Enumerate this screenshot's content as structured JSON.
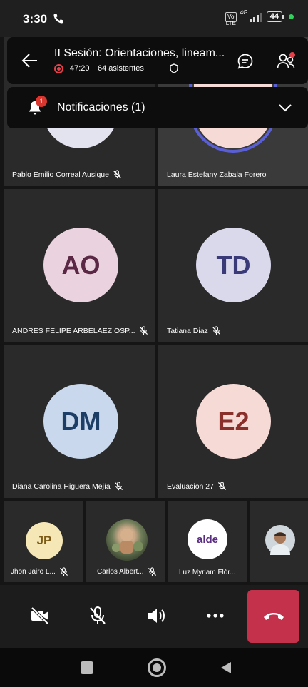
{
  "status_bar": {
    "time": "3:30",
    "network": "4G",
    "volte": "Vo LTE",
    "battery": "44"
  },
  "meeting": {
    "title": "II Sesión: Orientaciones, lineam...",
    "duration": "47:20",
    "attendees": "64 asistentes",
    "icons": [
      "back-arrow-icon",
      "recording-icon",
      "shield-icon",
      "chat-icon",
      "people-icon"
    ]
  },
  "notifications": {
    "label": "Notificaciones (1)",
    "badge": "1"
  },
  "participants_large": [
    {
      "name": "Pablo Emilio Correal Ausique",
      "initials": "",
      "muted": true
    },
    {
      "name": "Laura Estefany Zabala Forero",
      "initials": "",
      "muted": false
    },
    {
      "name": "ANDRES FELIPE ARBELAEZ OSP...",
      "initials": "AO",
      "muted": true,
      "avatar_bg": "#ead3df",
      "avatar_fg": "#5a2744"
    },
    {
      "name": "Tatiana Diaz",
      "initials": "TD",
      "muted": true,
      "avatar_bg": "#dad9ec",
      "avatar_fg": "#3a3a78"
    },
    {
      "name": "Diana Carolina Higuera Mejía",
      "initials": "DM",
      "muted": true,
      "avatar_bg": "#c9d8ec",
      "avatar_fg": "#1d3e66"
    },
    {
      "name": "Evaluacion 27",
      "initials": "E2",
      "muted": true,
      "avatar_bg": "#f6dad6",
      "avatar_fg": "#8a2f2a"
    }
  ],
  "participants_small": [
    {
      "name": "Jhon Jairo L...",
      "initials": "JP",
      "muted": true,
      "avatar_bg": "#f6e7b7",
      "avatar_fg": "#7a5a14"
    },
    {
      "name": "Carlos Albert...",
      "initials": "",
      "muted": true
    },
    {
      "name": "Luz Myriam Flór...",
      "initials": "",
      "logo_text": "alde",
      "muted": false
    },
    {
      "name": "",
      "initials": "",
      "muted": false
    }
  ],
  "controls": {
    "icons": [
      "camera-off-icon",
      "mic-off-icon",
      "speaker-icon",
      "more-icon",
      "hang-up-icon"
    ]
  },
  "colors": {
    "leave": "#c4314b",
    "recording": "#e4404a",
    "badge": "#d9362f",
    "stage": "#151515",
    "tile": "#2a2a2a"
  }
}
